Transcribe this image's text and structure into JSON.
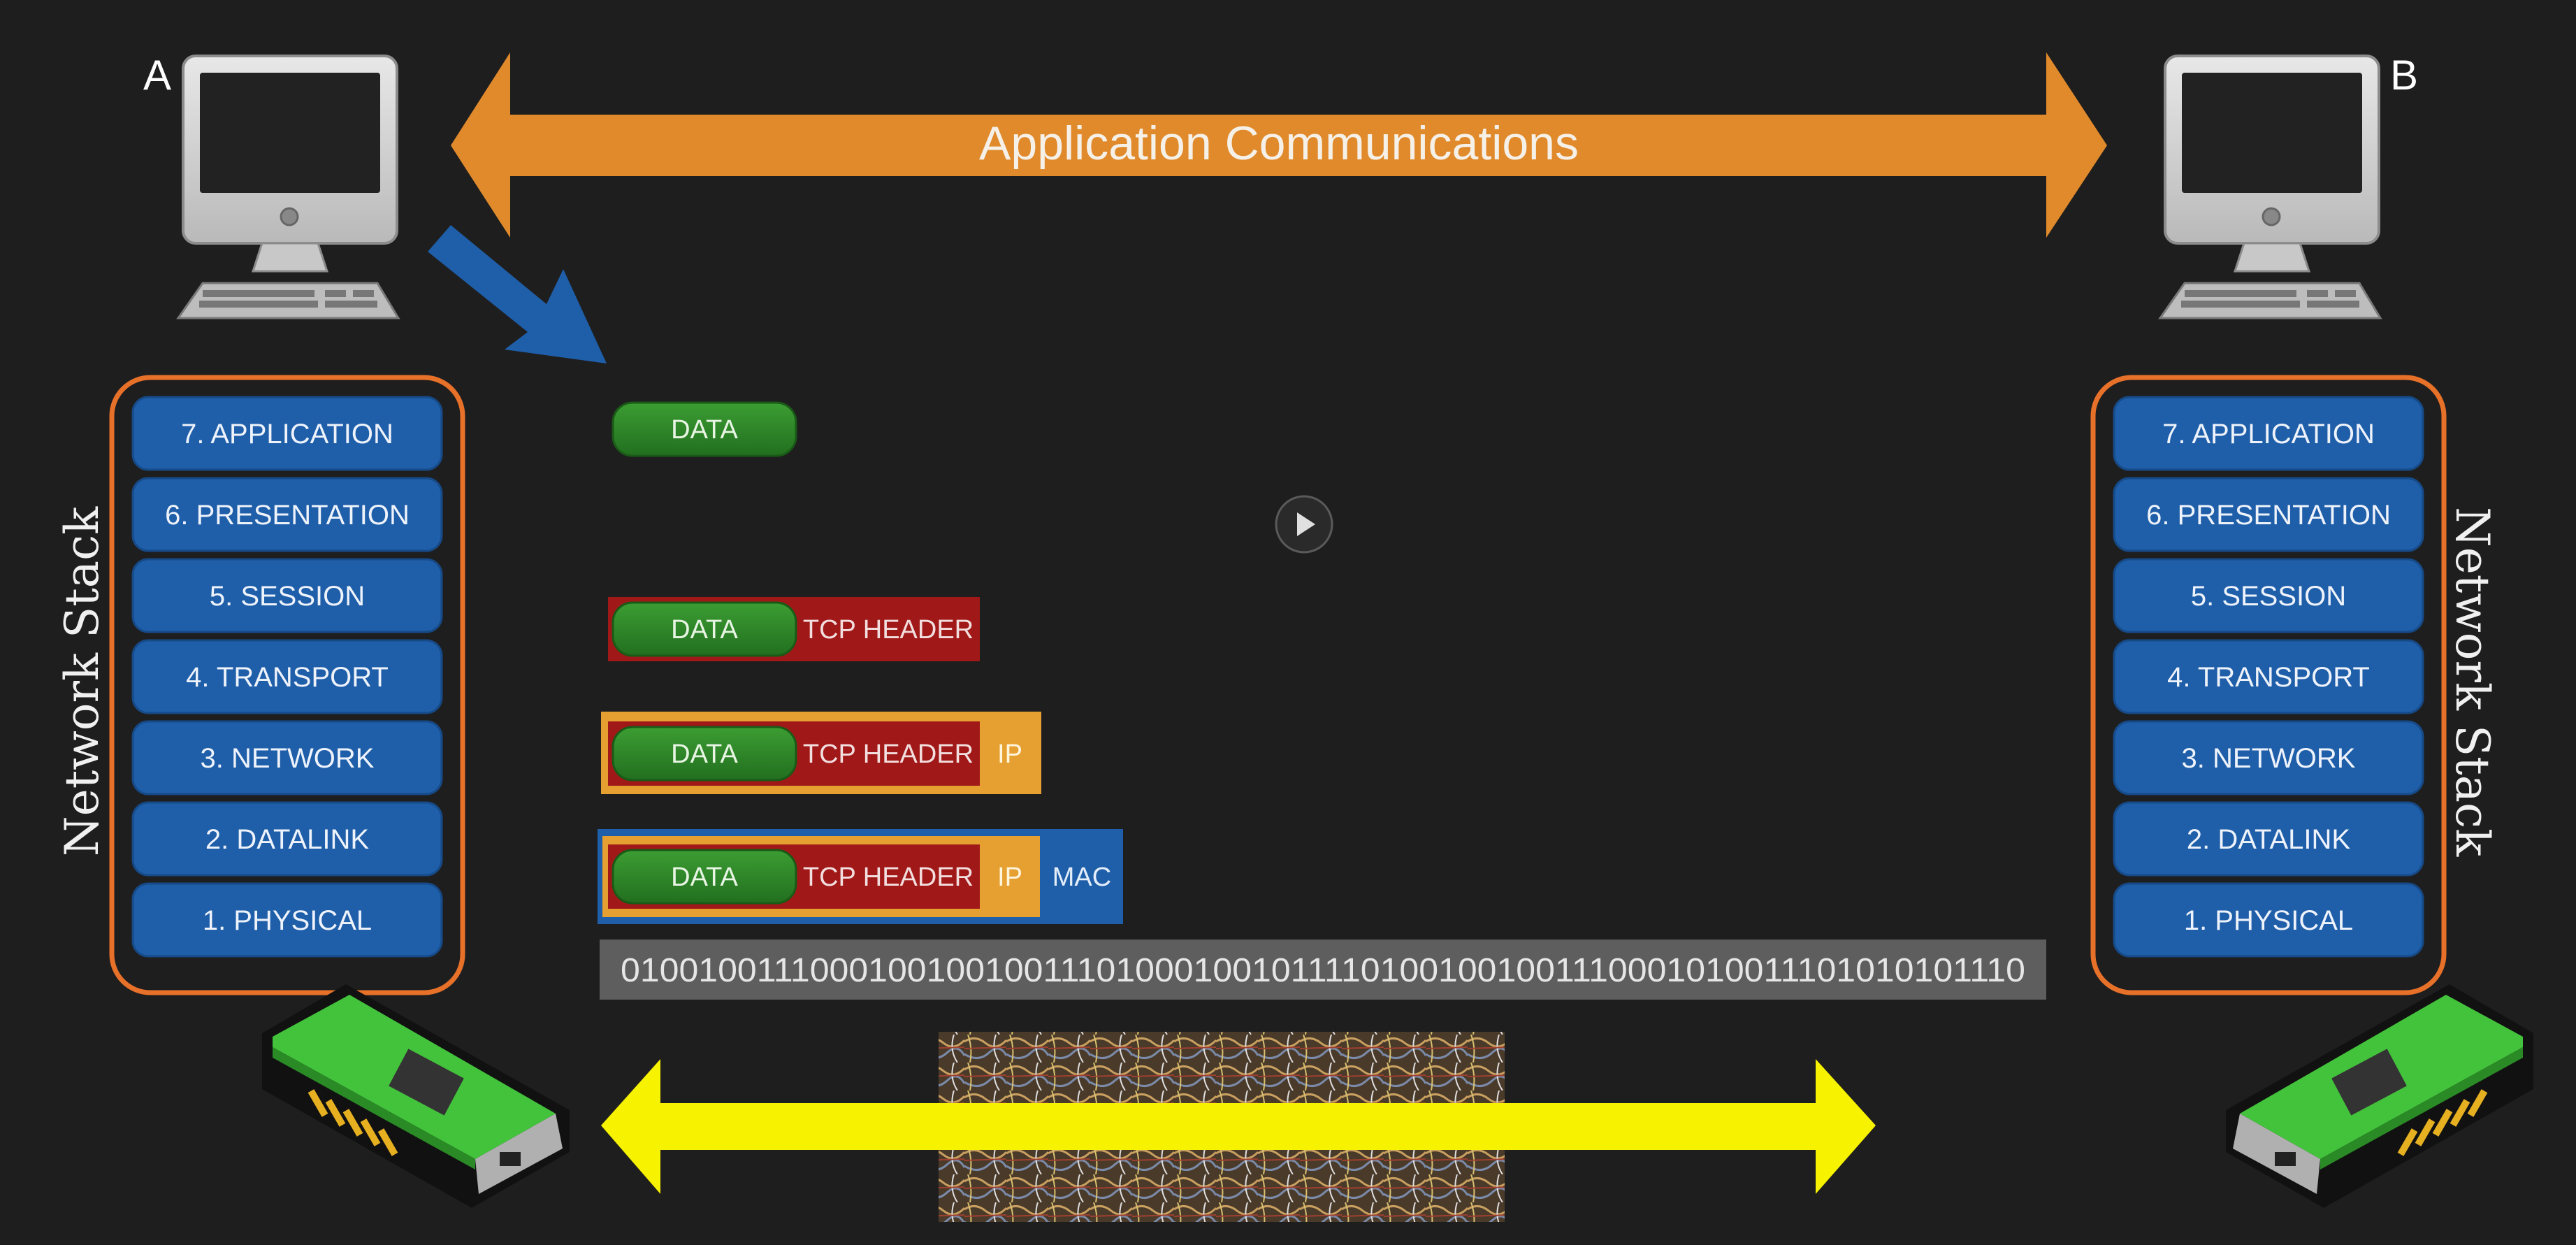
{
  "hosts": {
    "left_label": "A",
    "right_label": "B"
  },
  "app_comm": {
    "label": "Application Communications",
    "color": "#e08a2c"
  },
  "stack": {
    "title": "Network Stack",
    "layers": [
      "7. APPLICATION",
      "6. PRESENTATION",
      "5. SESSION",
      "4. TRANSPORT",
      "3. NETWORK",
      "2. DATALINK",
      "1. PHYSICAL"
    ],
    "layer_color": "#1f5ea8",
    "border_color": "#e8712a"
  },
  "encapsulation": {
    "data": "DATA",
    "tcp": "TCP HEADER",
    "ip": "IP",
    "mac": "MAC",
    "colors": {
      "data": "#2e8a2a",
      "tcp": "#a01818",
      "ip": "#e6a032",
      "mac": "#1f5ea8"
    }
  },
  "binary": {
    "text": "01001001110001001001001110100010010111101001001001110001010011101010101110"
  },
  "physical_link": {
    "arrow_color": "#f7f200"
  },
  "player": {
    "play_icon": "play-icon"
  }
}
